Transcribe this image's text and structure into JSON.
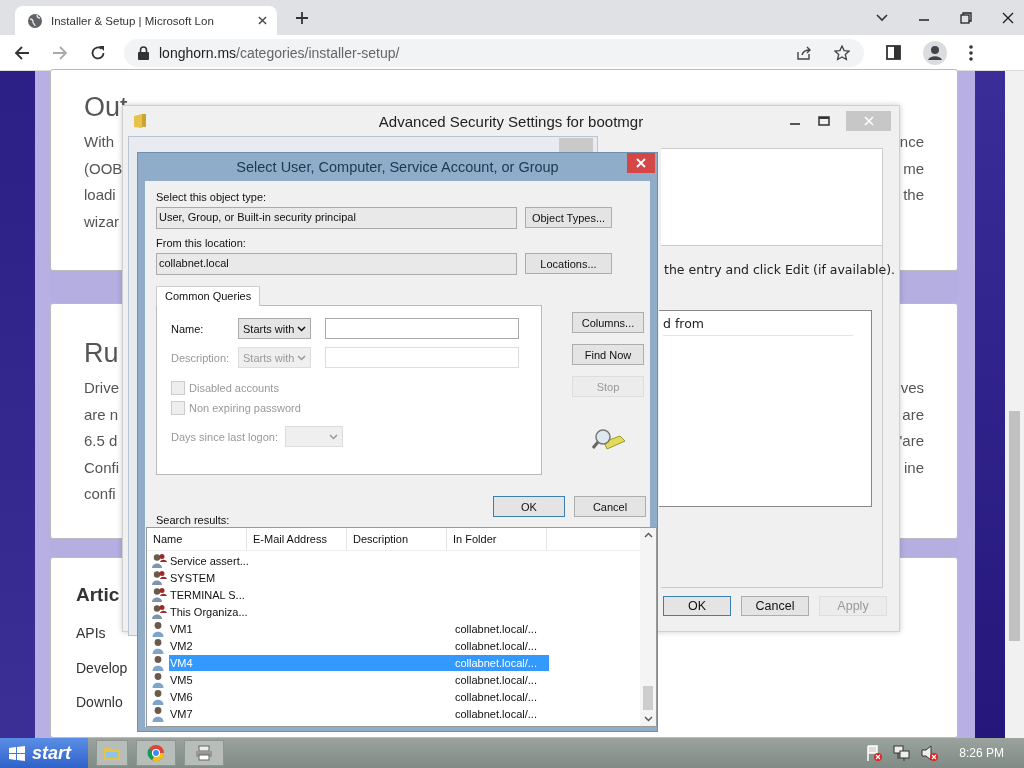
{
  "browser": {
    "tab_title": "Installer & Setup | Microsoft Lon",
    "url_host": "longhorn.ms",
    "url_path": "/categories/installer-setup/"
  },
  "page": {
    "cards": [
      {
        "kind": "text",
        "heading": "Out",
        "lines": [
          {
            "start": "With",
            "end": "nce"
          },
          {
            "start": "(OOB",
            "end": "me"
          },
          {
            "start": "loadi",
            "end": "the"
          },
          {
            "start": "wizar"
          }
        ]
      },
      {
        "kind": "text",
        "heading": "Ru",
        "lines": [
          {
            "start": "Drive",
            "end": "ves"
          },
          {
            "start": "are n",
            "end": "are"
          },
          {
            "start": "6.5  d",
            "end": "'are"
          },
          {
            "start": "Confi",
            "end": "ine"
          },
          {
            "start": "confi"
          }
        ]
      },
      {
        "kind": "links",
        "heading": "Artic",
        "links": [
          "APIs",
          "Develop",
          "Downlo"
        ]
      }
    ]
  },
  "advanced_window": {
    "title": "Advanced Security Settings for bootmgr",
    "instruction": "the entry and click Edit (if available).",
    "list_header": "d from",
    "buttons": [
      {
        "label": "OK",
        "default": true,
        "disabled": false
      },
      {
        "label": "Cancel",
        "default": false,
        "disabled": false
      },
      {
        "label": "Apply",
        "default": false,
        "disabled": true
      }
    ]
  },
  "dialog": {
    "title": "Select User, Computer, Service Account, or Group",
    "object_type_label": "Select this object type:",
    "object_type_value": "User, Group, or Built-in security principal",
    "object_types_button": "Object Types...",
    "location_label": "From this location:",
    "location_value": "collabnet.local",
    "locations_button": "Locations...",
    "tabs": [
      {
        "label": "Common Queries",
        "selected": true
      }
    ],
    "name_label": "Name:",
    "name_match": "Starts with",
    "name_disabled": false,
    "description_label": "Description:",
    "description_match": "Starts with",
    "description_disabled": true,
    "checkboxes": [
      {
        "label": "Disabled accounts",
        "checked": false,
        "disabled": true
      },
      {
        "label": "Non expiring password",
        "checked": false,
        "disabled": true
      }
    ],
    "days_label": "Days since last logon:",
    "side_buttons": [
      {
        "label": "Columns...",
        "disabled": false
      },
      {
        "label": "Find Now",
        "disabled": false
      },
      {
        "label": "Stop",
        "disabled": true
      }
    ],
    "ok_button": "OK",
    "cancel_button": "Cancel",
    "search_results_label": "Search results:",
    "columns": [
      "Name",
      "E-Mail Address",
      "Description",
      "In Folder"
    ],
    "rows": [
      {
        "name": "Service assert...",
        "kind": "builtin",
        "selected": false
      },
      {
        "name": "SYSTEM",
        "kind": "builtin",
        "selected": false
      },
      {
        "name": "TERMINAL S...",
        "kind": "builtin",
        "selected": false
      },
      {
        "name": "This Organiza...",
        "kind": "builtin",
        "selected": false
      },
      {
        "name": "VM1",
        "folder": "collabnet.local/...",
        "kind": "user",
        "selected": false
      },
      {
        "name": "VM2",
        "folder": "collabnet.local/...",
        "kind": "user",
        "selected": false
      },
      {
        "name": "VM4",
        "folder": "collabnet.local/...",
        "kind": "user",
        "selected": true
      },
      {
        "name": "VM5",
        "folder": "collabnet.local/...",
        "kind": "user",
        "selected": false
      },
      {
        "name": "VM6",
        "folder": "collabnet.local/...",
        "kind": "user",
        "selected": false
      },
      {
        "name": "VM7",
        "folder": "collabnet.local/...",
        "kind": "user",
        "selected": false
      }
    ]
  },
  "taskbar": {
    "start": "start",
    "clock": "8:26 PM"
  }
}
